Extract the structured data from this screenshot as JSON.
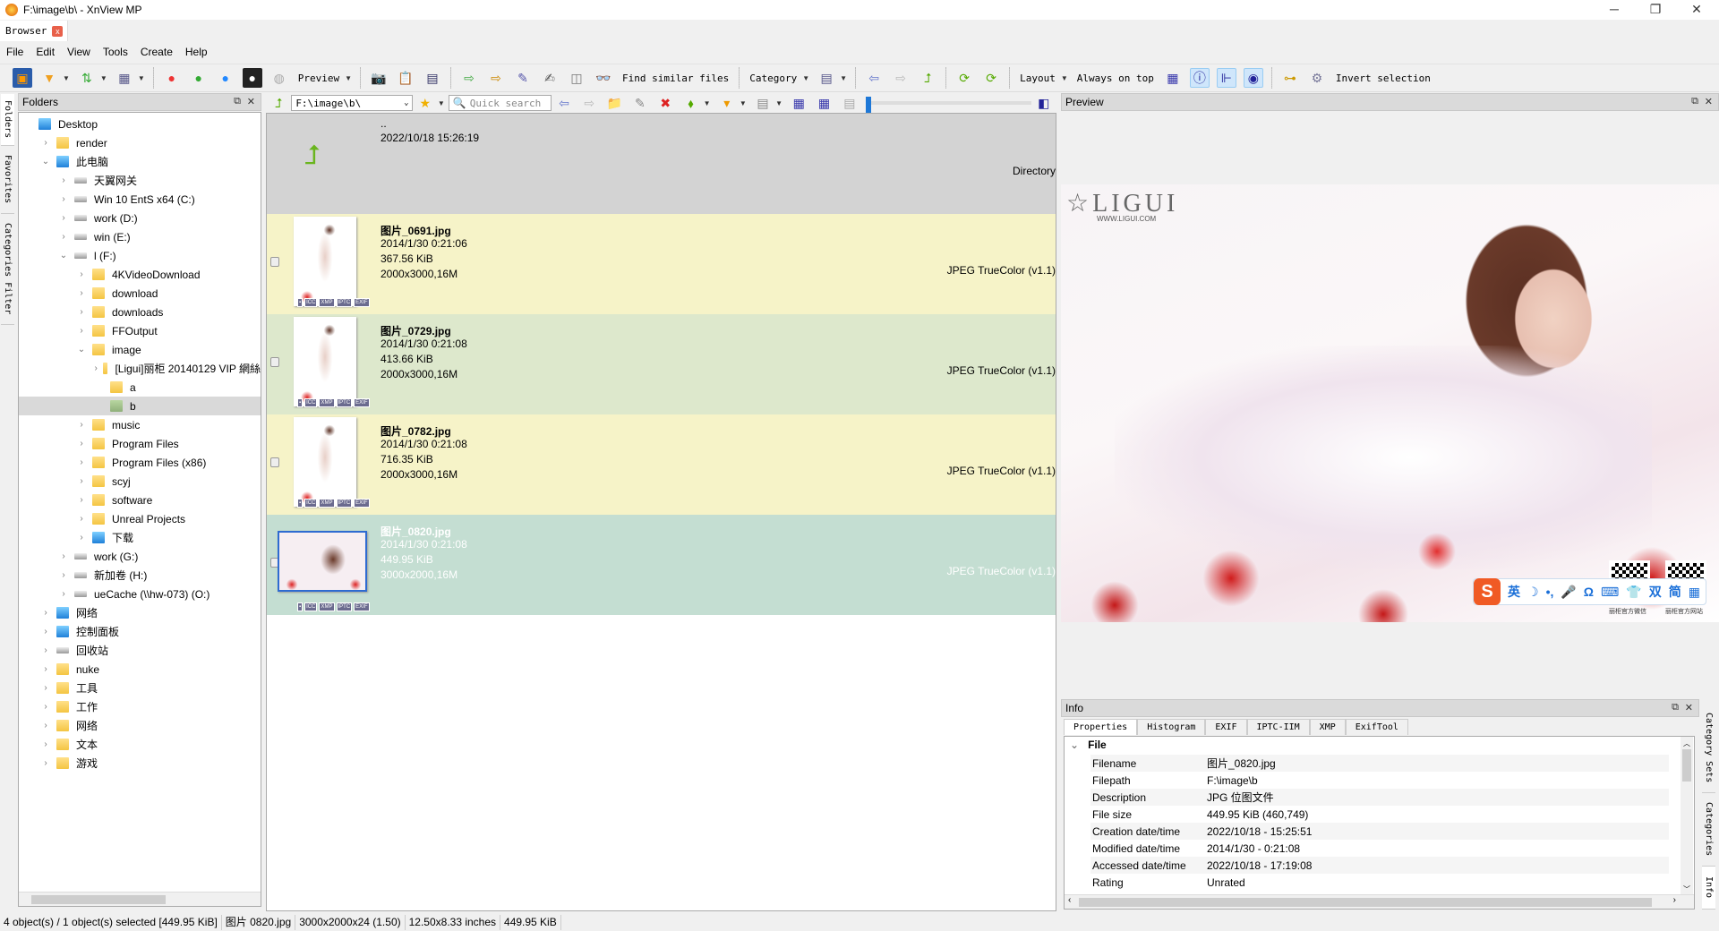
{
  "window": {
    "title": "F:\\image\\b\\ - XnView MP",
    "minimize": "─",
    "maximize": "❐",
    "close": "✕"
  },
  "tab": {
    "label": "Browser",
    "close": "x"
  },
  "menu": [
    "File",
    "Edit",
    "View",
    "Tools",
    "Create",
    "Help"
  ],
  "toolbar": {
    "preview": "Preview",
    "find_similar": "Find similar files",
    "category": "Category",
    "layout": "Layout",
    "always_on_top": "Always on top",
    "invert_selection": "Invert selection"
  },
  "side_tabs_left": [
    "Folders",
    "Favorites",
    "Categories Filter"
  ],
  "side_tabs_right": [
    "Category Sets",
    "Categories",
    "Info"
  ],
  "folders_panel": {
    "title": "Folders",
    "tree": [
      {
        "label": "Desktop",
        "level": 0,
        "icon": "desktop",
        "exp": ""
      },
      {
        "label": "render",
        "level": 1,
        "icon": "user-folder",
        "exp": "›"
      },
      {
        "label": "此电脑",
        "level": 1,
        "icon": "pc",
        "exp": "⌄"
      },
      {
        "label": "天翼网关",
        "level": 2,
        "icon": "network-drive",
        "exp": "›"
      },
      {
        "label": "Win 10 EntS x64 (C:)",
        "level": 2,
        "icon": "drive",
        "exp": "›"
      },
      {
        "label": "work (D:)",
        "level": 2,
        "icon": "drive",
        "exp": "›"
      },
      {
        "label": "win (E:)",
        "level": 2,
        "icon": "drive",
        "exp": "›"
      },
      {
        "label": "l (F:)",
        "level": 2,
        "icon": "drive",
        "exp": "⌄"
      },
      {
        "label": "4KVideoDownload",
        "level": 3,
        "icon": "folder",
        "exp": "›"
      },
      {
        "label": "download",
        "level": 3,
        "icon": "folder",
        "exp": "›"
      },
      {
        "label": "downloads",
        "level": 3,
        "icon": "folder",
        "exp": "›"
      },
      {
        "label": "FFOutput",
        "level": 3,
        "icon": "folder",
        "exp": "›"
      },
      {
        "label": "image",
        "level": 3,
        "icon": "folder",
        "exp": "⌄"
      },
      {
        "label": "[Ligui]丽柜 20140129 VIP 網絲",
        "level": 4,
        "icon": "folder",
        "exp": "›"
      },
      {
        "label": "a",
        "level": 4,
        "icon": "folder",
        "exp": ""
      },
      {
        "label": "b",
        "level": 4,
        "icon": "folder",
        "exp": "",
        "selected": true
      },
      {
        "label": "music",
        "level": 3,
        "icon": "folder",
        "exp": "›"
      },
      {
        "label": "Program Files",
        "level": 3,
        "icon": "folder",
        "exp": "›"
      },
      {
        "label": "Program Files (x86)",
        "level": 3,
        "icon": "folder",
        "exp": "›"
      },
      {
        "label": "scyj",
        "level": 3,
        "icon": "folder",
        "exp": "›"
      },
      {
        "label": "software",
        "level": 3,
        "icon": "folder",
        "exp": "›"
      },
      {
        "label": "Unreal Projects",
        "level": 3,
        "icon": "folder",
        "exp": "›"
      },
      {
        "label": "下载",
        "level": 3,
        "icon": "download",
        "exp": "›"
      },
      {
        "label": "work (G:)",
        "level": 2,
        "icon": "drive",
        "exp": "›"
      },
      {
        "label": "新加卷 (H:)",
        "level": 2,
        "icon": "drive",
        "exp": "›"
      },
      {
        "label": "ueCache (\\\\hw-073) (O:)",
        "level": 2,
        "icon": "drive",
        "exp": "›"
      },
      {
        "label": "网络",
        "level": 1,
        "icon": "network",
        "exp": "›"
      },
      {
        "label": "控制面板",
        "level": 1,
        "icon": "control-panel",
        "exp": "›"
      },
      {
        "label": "回收站",
        "level": 1,
        "icon": "recycle-bin",
        "exp": "›"
      },
      {
        "label": "nuke",
        "level": 1,
        "icon": "folder",
        "exp": "›"
      },
      {
        "label": "工具",
        "level": 1,
        "icon": "folder",
        "exp": "›"
      },
      {
        "label": "工作",
        "level": 1,
        "icon": "folder",
        "exp": "›"
      },
      {
        "label": "网络",
        "level": 1,
        "icon": "folder",
        "exp": "›"
      },
      {
        "label": "文本",
        "level": 1,
        "icon": "folder",
        "exp": "›"
      },
      {
        "label": "游戏",
        "level": 1,
        "icon": "folder",
        "exp": "›"
      }
    ]
  },
  "path_bar": {
    "path": "F:\\image\\b\\",
    "search_placeholder": "Quick search"
  },
  "file_list": {
    "parent": {
      "name": "..",
      "date": "2022/10/18 15:26:19",
      "type": "Directory"
    },
    "files": [
      {
        "name": "图片_0691.jpg",
        "date": "2014/1/30 0:21:06",
        "size": "367.56 KiB",
        "dims": "2000x3000,16M",
        "type": "JPEG TrueColor (v1.1)",
        "bg": "#f6f3c8",
        "selected": false,
        "portrait": true
      },
      {
        "name": "图片_0729.jpg",
        "date": "2014/1/30 0:21:08",
        "size": "413.66 KiB",
        "dims": "2000x3000,16M",
        "type": "JPEG TrueColor (v1.1)",
        "bg": "#dde8cc",
        "selected": false,
        "portrait": true
      },
      {
        "name": "图片_0782.jpg",
        "date": "2014/1/30 0:21:08",
        "size": "716.35 KiB",
        "dims": "2000x3000,16M",
        "type": "JPEG TrueColor (v1.1)",
        "bg": "#f6f3c8",
        "selected": false,
        "portrait": true
      },
      {
        "name": "图片_0820.jpg",
        "date": "2014/1/30 0:21:08",
        "size": "449.95 KiB",
        "dims": "3000x2000,16M",
        "type": "JPEG TrueColor (v1.1)",
        "bg": "#c4ded2",
        "selected": true,
        "portrait": false
      }
    ],
    "badges": [
      "ICC",
      "XMP",
      "IPTC",
      "EXIF"
    ]
  },
  "preview": {
    "title": "Preview",
    "watermark": "LIGUI",
    "watermark_url": "WWW.LIGUI.COM",
    "ime": [
      "英",
      "☽",
      "•,",
      "🎤",
      "Ω",
      "⌨",
      "👕",
      "双",
      "简",
      "▦"
    ],
    "qr_captions": [
      "丽柜官方微信",
      "丽柜官方网站"
    ]
  },
  "info": {
    "title": "Info",
    "tabs": [
      "Properties",
      "Histogram",
      "EXIF",
      "IPTC-IIM",
      "XMP",
      "ExifTool"
    ],
    "section": "File",
    "props": [
      {
        "k": "Filename",
        "v": "图片_0820.jpg"
      },
      {
        "k": "Filepath",
        "v": "F:\\image\\b"
      },
      {
        "k": "Description",
        "v": "JPG 位图文件"
      },
      {
        "k": "File size",
        "v": "449.95 KiB (460,749)"
      },
      {
        "k": "Creation date/time",
        "v": "2022/10/18 - 15:25:51"
      },
      {
        "k": "Modified date/time",
        "v": "2014/1/30 - 0:21:08"
      },
      {
        "k": "Accessed date/time",
        "v": "2022/10/18 - 17:19:08"
      },
      {
        "k": "Rating",
        "v": "Unrated"
      }
    ]
  },
  "status": [
    "4 object(s) / 1 object(s) selected [449.95 KiB]",
    "图片 0820.jpg",
    "3000x2000x24 (1.50)",
    "12.50x8.33 inches",
    "449.95 KiB"
  ],
  "colors": {
    "selected_row": "#c4ded2",
    "row_yellow": "#f6f3c8",
    "row_green": "#dde8cc",
    "parent_row": "#d3d3d3",
    "accent": "#1e78d7"
  }
}
